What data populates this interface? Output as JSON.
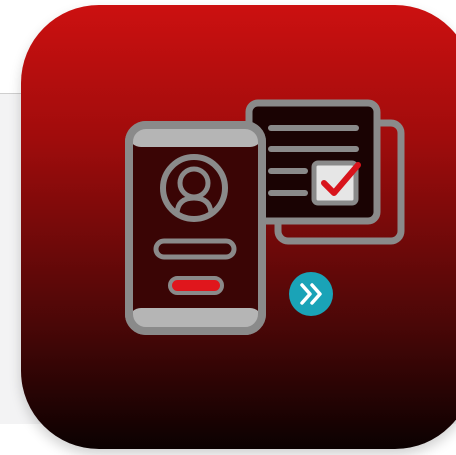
{
  "app_icon": {
    "name": "identity-verification-app-icon",
    "gradient": [
      "#cc1010",
      "#a00c0c",
      "#4a0707",
      "#0b0101"
    ],
    "outline_color": "#8a8a8a",
    "check_color": "#d8141c",
    "action_button_color": "#e0161c",
    "forward_badge_color": "#1aa3b7",
    "icons": [
      "smartphone-icon",
      "user-avatar-icon",
      "document-icon",
      "checkbox-check-icon",
      "double-chevron-right-icon"
    ]
  }
}
